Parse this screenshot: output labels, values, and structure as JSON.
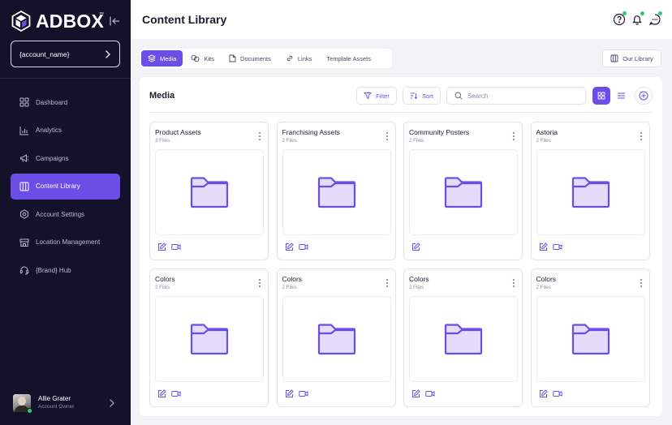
{
  "brand": {
    "name": "ADBOX",
    "tm": "™",
    "accent": "#6c4de6",
    "sidebar_bg": "#14112a"
  },
  "sidebar": {
    "account_name": "{account_name}",
    "items": [
      {
        "label": "Dashboard",
        "icon": "grid-icon"
      },
      {
        "label": "Analytics",
        "icon": "bar-chart-icon"
      },
      {
        "label": "Campaigns",
        "icon": "megaphone-icon"
      },
      {
        "label": "Content Library",
        "icon": "library-icon",
        "active": true
      },
      {
        "label": "Account Settings",
        "icon": "settings-icon"
      },
      {
        "label": "Location Management",
        "icon": "store-icon"
      },
      {
        "label": "{Brand} Hub",
        "icon": "headset-icon"
      }
    ],
    "user": {
      "name": "Allie Grater",
      "role": "Account Owner"
    }
  },
  "header": {
    "title": "Content Library"
  },
  "tabs": [
    {
      "label": "Media",
      "icon": "layers-icon",
      "active": true
    },
    {
      "label": "Kits",
      "icon": "kits-icon"
    },
    {
      "label": "Documents",
      "icon": "document-icon"
    },
    {
      "label": "Links",
      "icon": "link-icon"
    },
    {
      "label": "Template Assets",
      "icon": ""
    }
  ],
  "our_library_label": "Our Library",
  "panel": {
    "title": "Media",
    "filter_label": "Filter",
    "sort_label": "Sort",
    "search_placeholder": "Search"
  },
  "cards": [
    {
      "title": "Product Assets",
      "count": "3 Files",
      "video": true
    },
    {
      "title": "Franchising Assets",
      "count": "2 Files",
      "video": true
    },
    {
      "title": "Community Posters",
      "count": "2 Files",
      "video": false
    },
    {
      "title": "Astoria",
      "count": "2 Files",
      "video": true
    },
    {
      "title": "Colors",
      "count": "2 Files",
      "video": true
    },
    {
      "title": "Colors",
      "count": "2 Files",
      "video": true
    },
    {
      "title": "Colors",
      "count": "2 Files",
      "video": true
    },
    {
      "title": "Colors",
      "count": "2 Files",
      "video": true
    }
  ]
}
